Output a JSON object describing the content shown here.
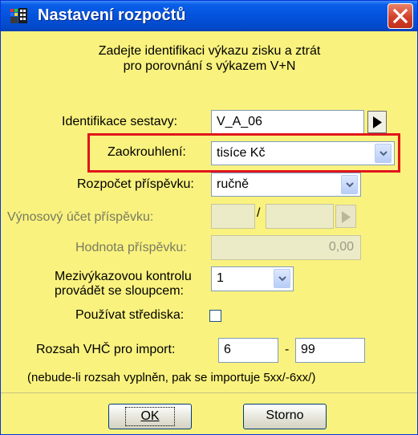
{
  "window": {
    "title": "Nastavení rozpočtů"
  },
  "intro": {
    "line1": "Zadejte identifikaci výkazu zisku a ztrát",
    "line2": "pro porovnání s výkazem V+N"
  },
  "form": {
    "identifikace": {
      "label": "Identifikace sestavy:",
      "value": "V_A_06"
    },
    "zaokrouhleni": {
      "label": "Zaokrouhlení:",
      "value": "tisíce Kč"
    },
    "rozpocet": {
      "label": "Rozpočet příspěvku:",
      "value": "ručně"
    },
    "vynosovy": {
      "label": "Výnosový účet příspěvku:",
      "separator": "/"
    },
    "hodnota": {
      "label": "Hodnota příspěvku:",
      "value": "0,00"
    },
    "mezivykazova": {
      "label_line1": "Mezivýkazovou kontrolu",
      "label_line2": "provádět se sloupcem:",
      "value": "1"
    },
    "strediska": {
      "label": "Používat střediska:",
      "checked": false
    },
    "rozsah": {
      "label": "Rozsah VHČ pro import:",
      "from": "6",
      "dash": "-",
      "to": "99"
    },
    "note": "(nebude-li rozsah vyplněn,  pak se importuje 5xx/-6xx/)"
  },
  "buttons": {
    "ok": "OK",
    "cancel": "Storno"
  },
  "colors": {
    "background": "#f9f27e",
    "titlebar": "#0452dc",
    "highlight": "#e0151b"
  }
}
